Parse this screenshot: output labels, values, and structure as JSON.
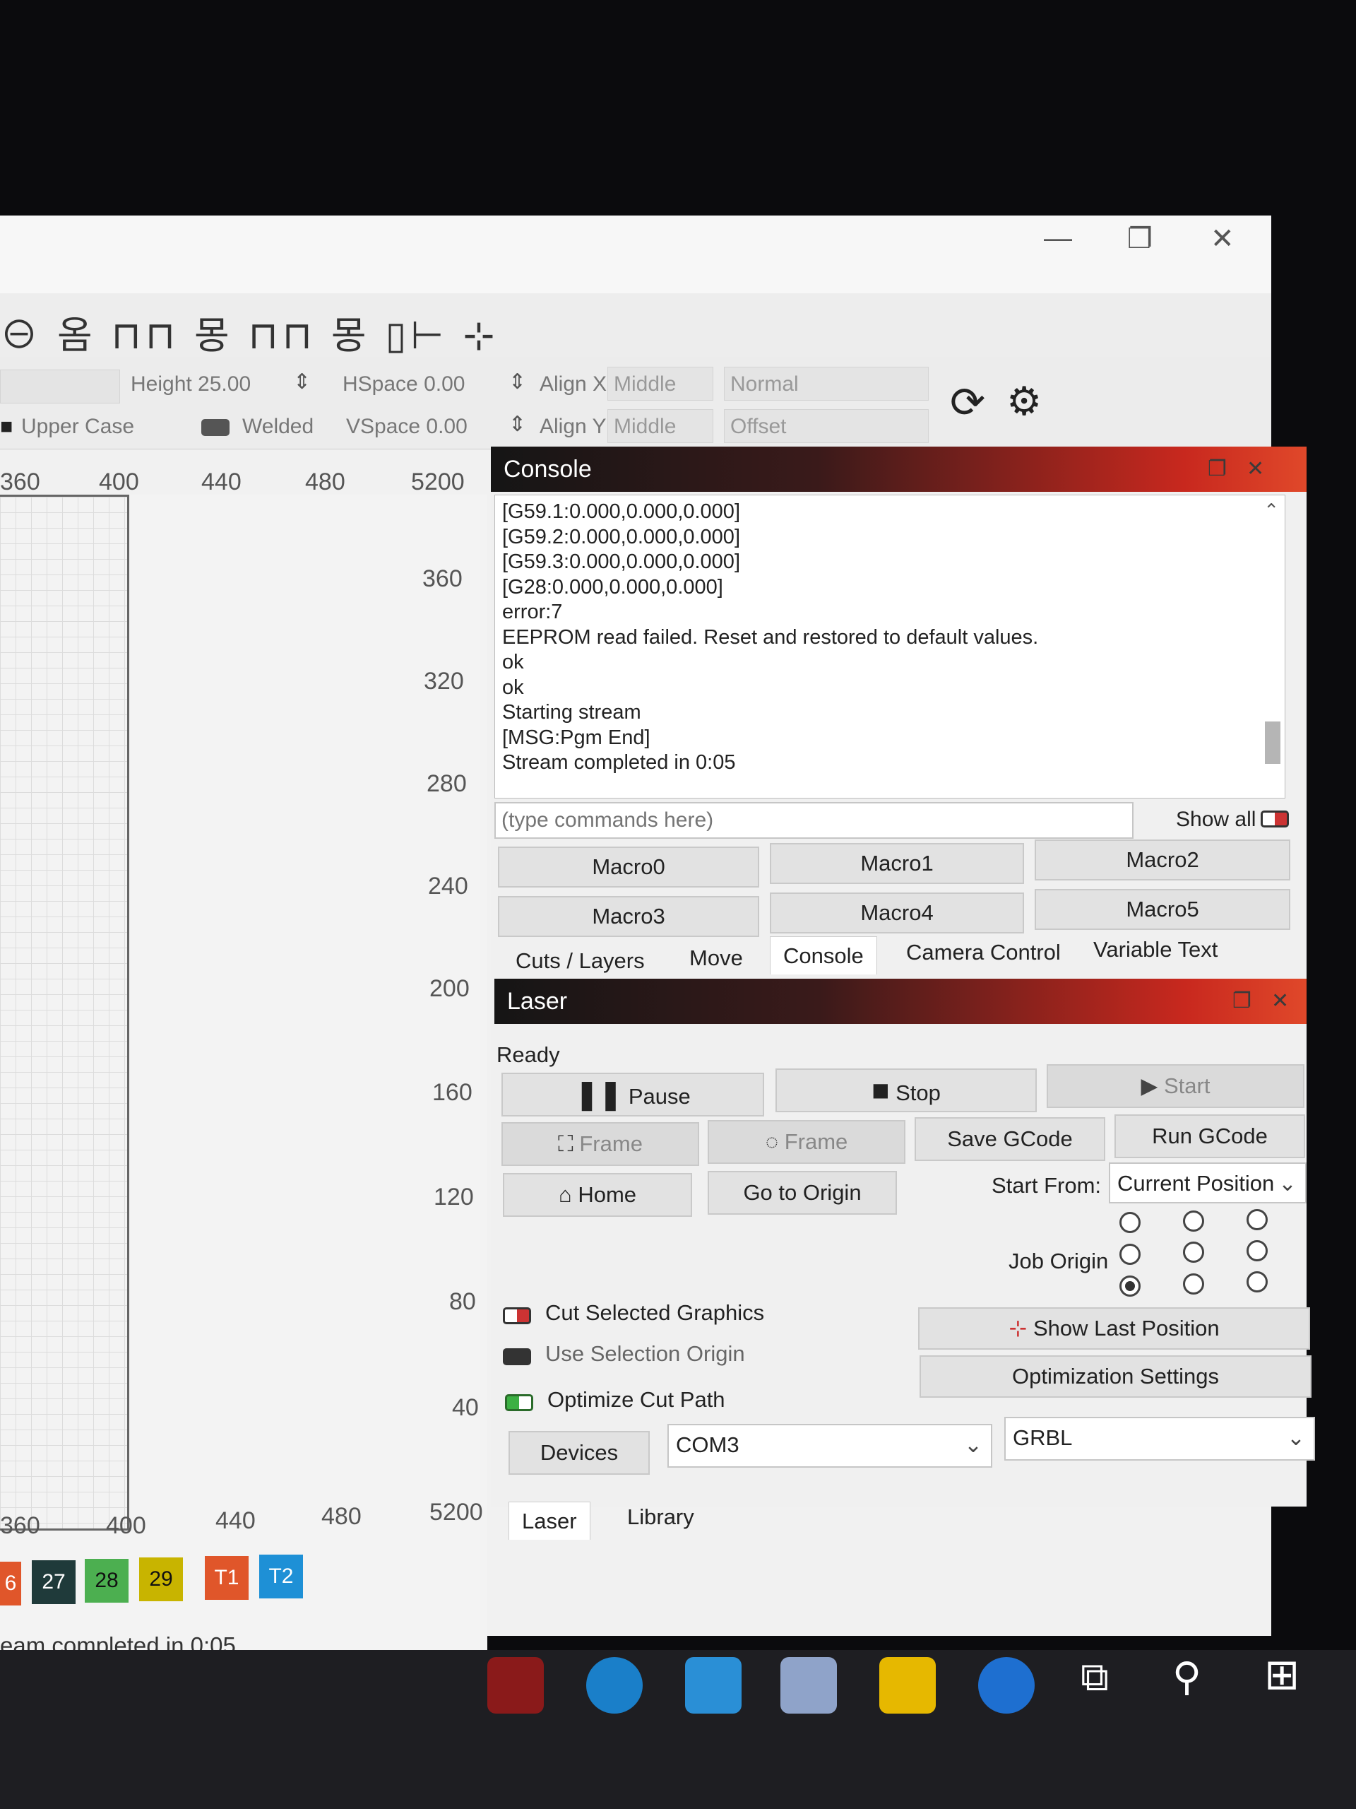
{
  "window": {
    "controls": {
      "minimize": "—",
      "restore": "❐",
      "close": "✕"
    }
  },
  "toolbar": {
    "glyphs": "⊖ 옴 ⊓⊓ 몽 ⊓⊓ 몽 ▯⊢ ⊹"
  },
  "properties": {
    "height_label": "Height 25.00",
    "hspace_label": "HSpace 0.00",
    "vspace_label": "VSpace 0.00",
    "align_x_label": "Align X",
    "align_x_value": "Middle",
    "align_y_label": "Align Y",
    "align_y_value": "Middle",
    "mode_value": "Normal",
    "offset_value": "Offset",
    "upper_case_label": "Upper Case",
    "welded_label": "Welded"
  },
  "rulers": {
    "top": [
      "360",
      "400",
      "440",
      "480",
      "5200"
    ],
    "bottom": [
      "360",
      "400",
      "440",
      "480",
      "5200"
    ],
    "vertical": [
      "360",
      "320",
      "280",
      "240",
      "200",
      "160",
      "120",
      "80",
      "40"
    ]
  },
  "console": {
    "title": "Console",
    "lines": [
      "[G59.1:0.000,0.000,0.000]",
      "[G59.2:0.000,0.000,0.000]",
      "[G59.3:0.000,0.000,0.000]",
      "[G28:0.000,0.000,0.000]",
      "error:7",
      "EEPROM read failed. Reset and restored to default values.",
      "ok",
      "ok",
      "Starting stream",
      "[MSG:Pgm End]",
      "Stream completed in 0:05"
    ],
    "input_placeholder": "(type commands here)",
    "show_all_label": "Show all",
    "macros": [
      "Macro0",
      "Macro1",
      "Macro2",
      "Macro3",
      "Macro4",
      "Macro5"
    ],
    "tabs": [
      "Cuts / Layers",
      "Move",
      "Console",
      "Camera Control",
      "Variable Text"
    ]
  },
  "laser": {
    "title": "Laser",
    "status": "Ready",
    "pause_label": "Pause",
    "stop_label": "Stop",
    "start_label": "Start",
    "frame_rect_label": "Frame",
    "frame_circle_label": "Frame",
    "save_gcode_label": "Save GCode",
    "run_gcode_label": "Run GCode",
    "home_label": "Home",
    "go_to_origin_label": "Go to Origin",
    "start_from_label": "Start From:",
    "start_from_value": "Current Position",
    "job_origin_label": "Job Origin",
    "cut_selected_label": "Cut Selected Graphics",
    "use_selection_origin_label": "Use Selection Origin",
    "optimize_cut_path_label": "Optimize Cut Path",
    "show_last_position_label": "Show Last Position",
    "optimization_settings_label": "Optimization Settings",
    "devices_label": "Devices",
    "port_value": "COM3",
    "device_value": "GRBL",
    "bottom_tabs": [
      "Laser",
      "Library"
    ]
  },
  "palette": {
    "swatches": [
      "6",
      "27",
      "28",
      "29",
      "T1",
      "T2"
    ],
    "colors": [
      "#e0562a",
      "#1f3a3a",
      "#4caf50",
      "#c8b400",
      "#e0562a",
      "#1e90d6"
    ]
  },
  "statusbar": {
    "text": "eam completed in 0:05"
  },
  "colors": {
    "accent_red": "#c8281e",
    "panel_dark": "#151515",
    "toggle_on": "#3cb043",
    "toggle_red": "#cc3333"
  }
}
